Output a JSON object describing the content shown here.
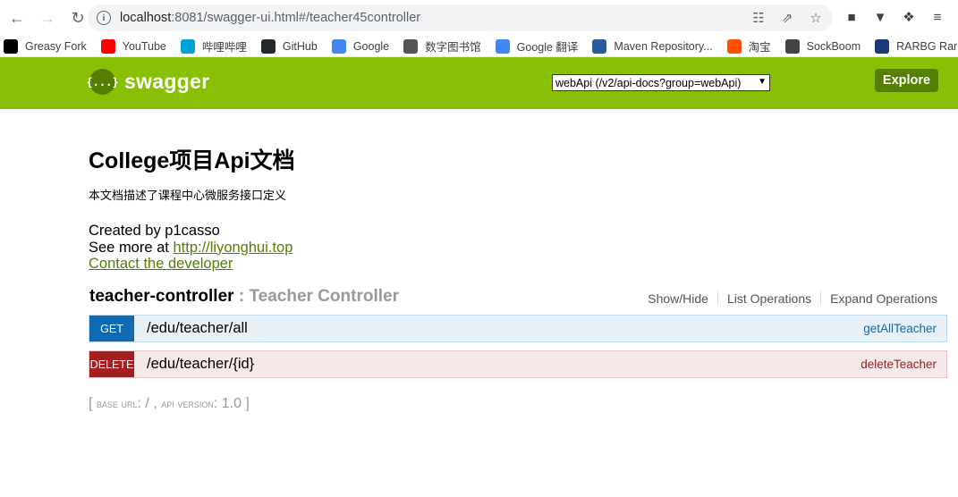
{
  "browser": {
    "url_host": "localhost",
    "url_rest": ":8081/swagger-ui.html#/teacher45controller"
  },
  "bookmarks": [
    {
      "label": "Greasy Fork",
      "icon": "greasyfork-icon",
      "color": "#000000"
    },
    {
      "label": "YouTube",
      "icon": "youtube-icon",
      "color": "#ff0000"
    },
    {
      "label": "哔哩哔哩",
      "icon": "bilibili-icon",
      "color": "#00a1d6"
    },
    {
      "label": "GitHub",
      "icon": "github-icon",
      "color": "#24292e"
    },
    {
      "label": "Google",
      "icon": "google-icon",
      "color": "#4285f4"
    },
    {
      "label": "数字图书馆",
      "icon": "library-icon",
      "color": "#555555"
    },
    {
      "label": "Google 翻译",
      "icon": "google-translate-icon",
      "color": "#4285f4"
    },
    {
      "label": "Maven Repository...",
      "icon": "maven-icon",
      "color": "#2a5b9a"
    },
    {
      "label": "淘宝",
      "icon": "taobao-icon",
      "color": "#ff5000"
    },
    {
      "label": "SockBoom",
      "icon": "sockboom-icon",
      "color": "#444444"
    },
    {
      "label": "RARBG Rarb",
      "icon": "rarbg-icon",
      "color": "#1b3a7a"
    }
  ],
  "header": {
    "logo_text": "swagger",
    "logo_glyph": "{...}",
    "select_value": "webApi (/v2/api-docs?group=webApi)",
    "explore_label": "Explore",
    "accent_color": "#89bf04"
  },
  "info": {
    "title": "College项目Api文档",
    "description": "本文档描述了课程中心微服务接口定义",
    "created_by": "Created by p1casso",
    "see_more_prefix": "See more at ",
    "see_more_link": "http://liyonghui.top",
    "contact": "Contact the developer"
  },
  "resource": {
    "name": "teacher-controller",
    "separator": " : ",
    "description": "Teacher Controller",
    "links": [
      "Show/Hide",
      "List Operations",
      "Expand Operations"
    ],
    "operations": [
      {
        "method": "GET",
        "path": "/edu/teacher/all",
        "operation_id": "getAllTeacher"
      },
      {
        "method": "DELETE",
        "path": "/edu/teacher/{id}",
        "operation_id": "deleteTeacher"
      }
    ]
  },
  "footer": {
    "open": "[ ",
    "base_url_label": "base url",
    "base_url_value": ": / , ",
    "api_version_label": "api version",
    "api_version_value": ": 1.0 ]"
  }
}
